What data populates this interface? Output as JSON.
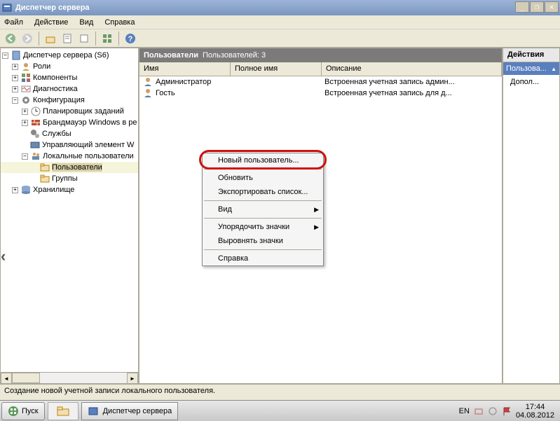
{
  "window": {
    "title": "Диспетчер сервера"
  },
  "menu": {
    "file": "Файл",
    "action": "Действие",
    "view": "Вид",
    "help": "Справка"
  },
  "tree": {
    "root": "Диспетчер сервера (S6)",
    "roles": "Роли",
    "components": "Компоненты",
    "diagnostics": "Диагностика",
    "config": "Конфигурация",
    "scheduler": "Планировщик заданий",
    "firewall": "Брандмауэр Windows в ре",
    "services": "Службы",
    "wmi": "Управляющий элемент W",
    "localusers": "Локальные пользователи",
    "users": "Пользователи",
    "groups": "Группы",
    "storage": "Хранилище"
  },
  "main": {
    "title": "Пользователи",
    "count": "Пользователей: 3",
    "cols": {
      "name": "Имя",
      "fullname": "Полное имя",
      "desc": "Описание"
    },
    "rows": [
      {
        "name": "Администратор",
        "fullname": "",
        "desc": "Встроенная учетная запись админ..."
      },
      {
        "name": "Гость",
        "fullname": "",
        "desc": "Встроенная учетная запись для д..."
      }
    ]
  },
  "ctx": {
    "newuser": "Новый пользователь...",
    "refresh": "Обновить",
    "export": "Экспортировать список...",
    "view": "Вид",
    "arrange": "Упорядочить значки",
    "align": "Выровнять значки",
    "help": "Справка"
  },
  "actions": {
    "title": "Действия",
    "section": "Пользова...",
    "more": "Допол..."
  },
  "status": "Создание новой учетной записи локального пользователя.",
  "taskbar": {
    "start": "Пуск",
    "app": "Диспетчер сервера",
    "lang": "EN",
    "time": "17:44",
    "date": "04.08.2012"
  }
}
